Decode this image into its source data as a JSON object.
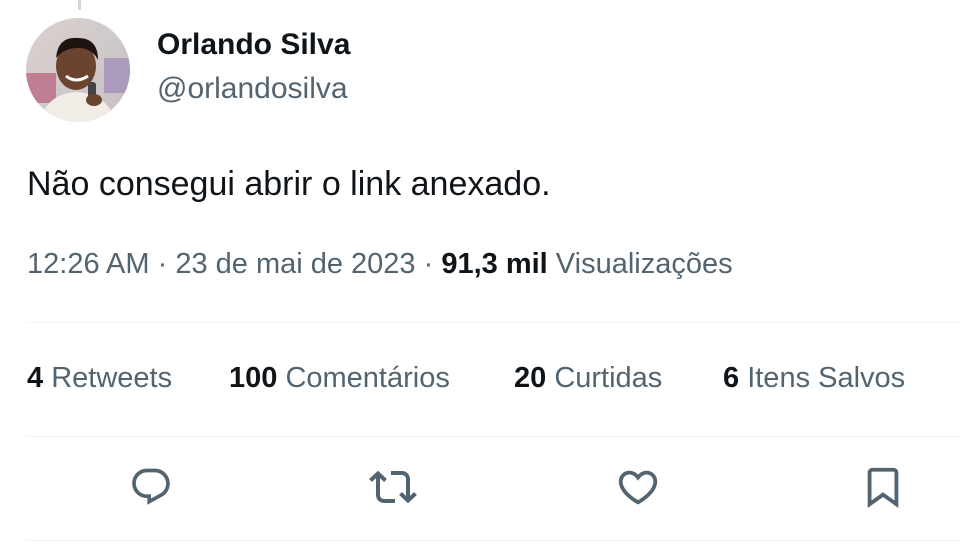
{
  "author": {
    "display_name": "Orlando Silva",
    "handle": "@orlandosilva",
    "avatar_icon": "profile-photo"
  },
  "tweet": {
    "text": "Não consegui abrir o link anexado."
  },
  "meta": {
    "time": "12:26 AM",
    "separator1": " · ",
    "date": "23 de mai de 2023",
    "separator2": " · ",
    "views_count": "91,3 mil",
    "views_label": " Visualizações"
  },
  "stats": {
    "retweets": {
      "count": "4",
      "label": " Retweets"
    },
    "comments": {
      "count": "100",
      "label": " Comentários"
    },
    "likes": {
      "count": "20",
      "label": " Curtidas"
    },
    "bookmarks": {
      "count": "6",
      "label": " Itens Salvos"
    }
  },
  "actions": [
    {
      "icon": "reply-icon"
    },
    {
      "icon": "retweet-icon"
    },
    {
      "icon": "like-icon"
    },
    {
      "icon": "bookmark-icon"
    }
  ],
  "colors": {
    "primary_text": "#0f1419",
    "secondary_text": "#536471",
    "divider": "#eff3f4"
  }
}
